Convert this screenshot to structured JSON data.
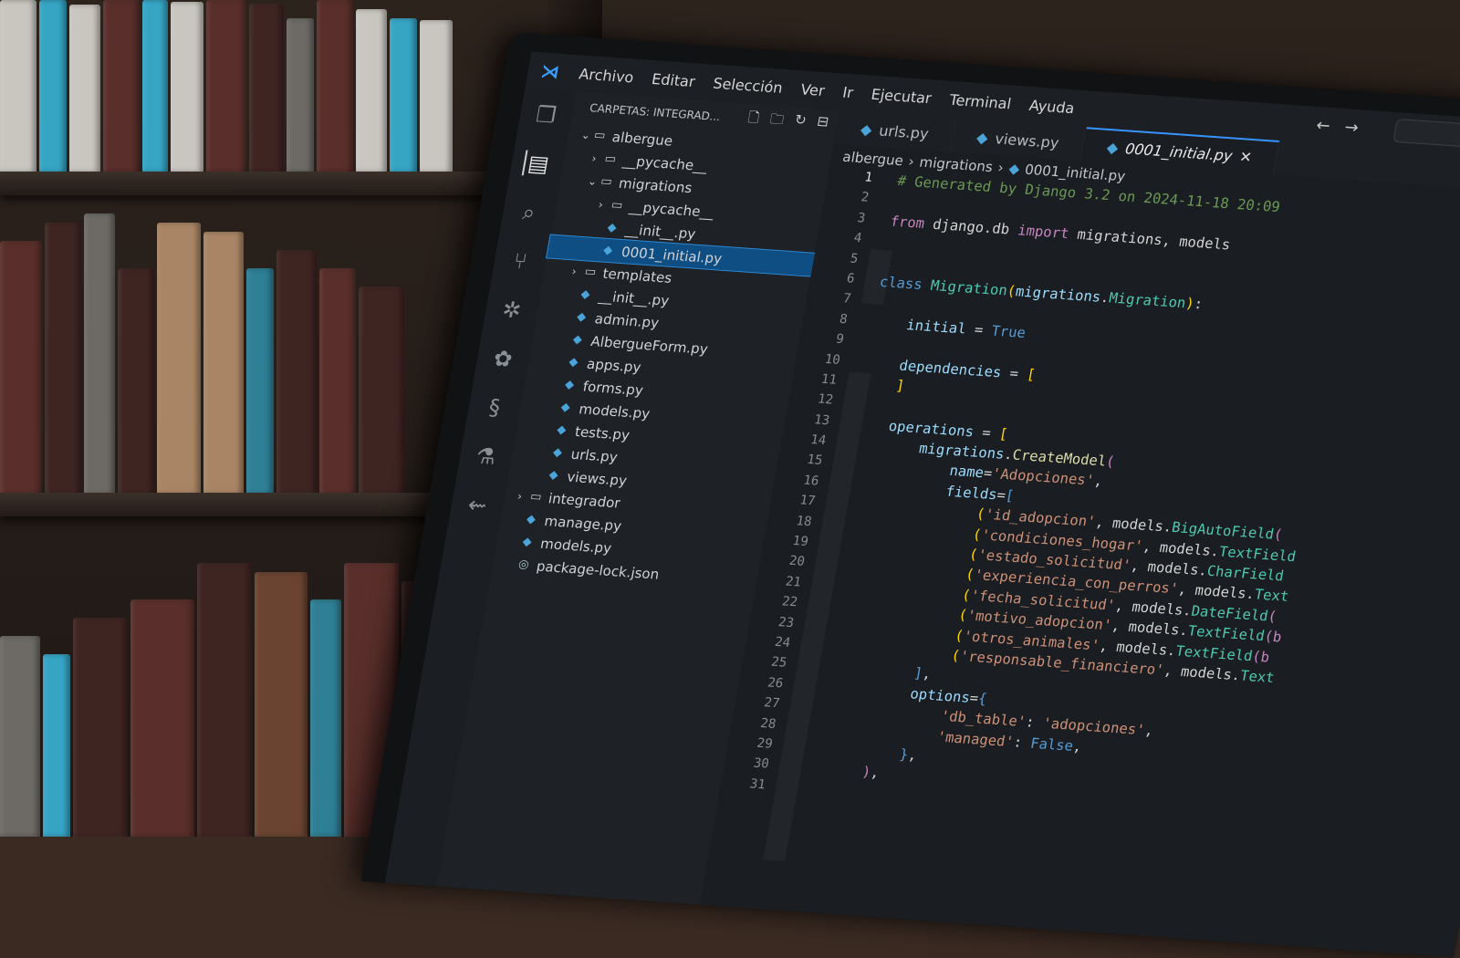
{
  "menu": {
    "items": [
      "Archivo",
      "Editar",
      "Selección",
      "Ver",
      "Ir",
      "Ejecutar",
      "Terminal",
      "Ayuda"
    ],
    "back_arrow": "←",
    "forward_arrow": "→"
  },
  "activity_bar": [
    "files-icon",
    "explorer-icon",
    "search-icon",
    "source-control-icon",
    "debug-icon",
    "extensions-icon",
    "python-icon",
    "testing-icon",
    "remote-icon"
  ],
  "sidebar": {
    "header": "CARPETAS: INTEGRAD...",
    "tree": [
      {
        "label": "albergue",
        "type": "folder",
        "open": true,
        "indent": 0
      },
      {
        "label": "__pycache__",
        "type": "folder",
        "open": false,
        "indent": 1
      },
      {
        "label": "migrations",
        "type": "folder",
        "open": true,
        "indent": 1
      },
      {
        "label": "__pycache__",
        "type": "folder",
        "open": false,
        "indent": 2
      },
      {
        "label": "__init__.py",
        "type": "py",
        "indent": 2
      },
      {
        "label": "0001_initial.py",
        "type": "py",
        "indent": 2,
        "selected": true
      },
      {
        "label": "templates",
        "type": "folder",
        "open": false,
        "indent": 1
      },
      {
        "label": "__init__.py",
        "type": "py",
        "indent": 1
      },
      {
        "label": "admin.py",
        "type": "py",
        "indent": 1
      },
      {
        "label": "AlbergueForm.py",
        "type": "py",
        "indent": 1
      },
      {
        "label": "apps.py",
        "type": "py",
        "indent": 1
      },
      {
        "label": "forms.py",
        "type": "py",
        "indent": 1
      },
      {
        "label": "models.py",
        "type": "py",
        "indent": 1
      },
      {
        "label": "tests.py",
        "type": "py",
        "indent": 1
      },
      {
        "label": "urls.py",
        "type": "py",
        "indent": 1
      },
      {
        "label": "views.py",
        "type": "py",
        "indent": 1
      },
      {
        "label": "integrador",
        "type": "folder",
        "open": false,
        "indent": 0
      },
      {
        "label": "manage.py",
        "type": "py",
        "indent": 0
      },
      {
        "label": "models.py",
        "type": "py",
        "indent": 0
      },
      {
        "label": "package-lock.json",
        "type": "json",
        "indent": 0
      }
    ]
  },
  "tabs": [
    {
      "label": "urls.py",
      "active": false
    },
    {
      "label": "views.py",
      "active": false
    },
    {
      "label": "0001_initial.py",
      "active": true
    }
  ],
  "breadcrumb": [
    "albergue",
    "migrations",
    "0001_initial.py"
  ],
  "code": [
    [
      [
        "c-com",
        "# Generated by Django 3.2 on 2024-11-18 20:09"
      ]
    ],
    [],
    [
      [
        "c-kw",
        "from"
      ],
      [
        "src",
        " django.db "
      ],
      [
        "c-kw",
        "import"
      ],
      [
        "src",
        " migrations, models"
      ]
    ],
    [],
    [],
    [
      [
        "c-bool",
        "class"
      ],
      [
        "src",
        " "
      ],
      [
        "c-cls",
        "Migration"
      ],
      [
        "c-br",
        "("
      ],
      [
        "c-var",
        "migrations"
      ],
      [
        "src",
        "."
      ],
      [
        "c-cls",
        "Migration"
      ],
      [
        "c-br",
        ")"
      ],
      [
        "src",
        ":"
      ]
    ],
    [],
    [
      [
        "src",
        "    "
      ],
      [
        "c-var",
        "initial"
      ],
      [
        "src",
        " = "
      ],
      [
        "c-bool",
        "True"
      ]
    ],
    [],
    [
      [
        "src",
        "    "
      ],
      [
        "c-var",
        "dependencies"
      ],
      [
        "src",
        " = "
      ],
      [
        "c-br",
        "["
      ]
    ],
    [
      [
        "src",
        "    "
      ],
      [
        "c-br",
        "]"
      ]
    ],
    [],
    [
      [
        "src",
        "    "
      ],
      [
        "c-var",
        "operations"
      ],
      [
        "src",
        " = "
      ],
      [
        "c-br",
        "["
      ]
    ],
    [
      [
        "src",
        "        "
      ],
      [
        "c-var",
        "migrations"
      ],
      [
        "src",
        "."
      ],
      [
        "c-fn",
        "CreateModel"
      ],
      [
        "c-kw",
        "("
      ]
    ],
    [
      [
        "src",
        "            "
      ],
      [
        "c-var",
        "name"
      ],
      [
        "src",
        "="
      ],
      [
        "c-str",
        "'Adopciones'"
      ],
      [
        "src",
        ","
      ]
    ],
    [
      [
        "src",
        "            "
      ],
      [
        "c-var",
        "fields"
      ],
      [
        "src",
        "="
      ],
      [
        "c-bool",
        "["
      ]
    ],
    [
      [
        "src",
        "                "
      ],
      [
        "c-br",
        "("
      ],
      [
        "c-str",
        "'id_adopcion'"
      ],
      [
        "src",
        ", models."
      ],
      [
        "c-cls",
        "BigAutoField"
      ],
      [
        "c-kw",
        "("
      ]
    ],
    [
      [
        "src",
        "                "
      ],
      [
        "c-br",
        "("
      ],
      [
        "c-str",
        "'condiciones_hogar'"
      ],
      [
        "src",
        ", models."
      ],
      [
        "c-cls",
        "TextField"
      ]
    ],
    [
      [
        "src",
        "                "
      ],
      [
        "c-br",
        "("
      ],
      [
        "c-str",
        "'estado_solicitud'"
      ],
      [
        "src",
        ", models."
      ],
      [
        "c-cls",
        "CharField"
      ]
    ],
    [
      [
        "src",
        "                "
      ],
      [
        "c-br",
        "("
      ],
      [
        "c-str",
        "'experiencia_con_perros'"
      ],
      [
        "src",
        ", models."
      ],
      [
        "c-cls",
        "Text"
      ]
    ],
    [
      [
        "src",
        "                "
      ],
      [
        "c-br",
        "("
      ],
      [
        "c-str",
        "'fecha_solicitud'"
      ],
      [
        "src",
        ", models."
      ],
      [
        "c-cls",
        "DateField"
      ],
      [
        "c-kw",
        "("
      ]
    ],
    [
      [
        "src",
        "                "
      ],
      [
        "c-br",
        "("
      ],
      [
        "c-str",
        "'motivo_adopcion'"
      ],
      [
        "src",
        ", models."
      ],
      [
        "c-cls",
        "TextField"
      ],
      [
        "c-kw",
        "(b"
      ]
    ],
    [
      [
        "src",
        "                "
      ],
      [
        "c-br",
        "("
      ],
      [
        "c-str",
        "'otros_animales'"
      ],
      [
        "src",
        ", models."
      ],
      [
        "c-cls",
        "TextField"
      ],
      [
        "c-kw",
        "(b"
      ]
    ],
    [
      [
        "src",
        "                "
      ],
      [
        "c-br",
        "("
      ],
      [
        "c-str",
        "'responsable_financiero'"
      ],
      [
        "src",
        ", models."
      ],
      [
        "c-cls",
        "Text"
      ]
    ],
    [
      [
        "src",
        "            "
      ],
      [
        "c-bool",
        "]"
      ],
      [
        "src",
        ","
      ]
    ],
    [
      [
        "src",
        "            "
      ],
      [
        "c-var",
        "options"
      ],
      [
        "src",
        "="
      ],
      [
        "c-bool",
        "{"
      ]
    ],
    [
      [
        "src",
        "                "
      ],
      [
        "c-str",
        "'db_table'"
      ],
      [
        "src",
        ": "
      ],
      [
        "c-str",
        "'adopciones'"
      ],
      [
        "src",
        ","
      ]
    ],
    [
      [
        "src",
        "                "
      ],
      [
        "c-str",
        "'managed'"
      ],
      [
        "src",
        ": "
      ],
      [
        "c-bool",
        "False"
      ],
      [
        "src",
        ","
      ]
    ],
    [
      [
        "src",
        "            "
      ],
      [
        "c-bool",
        "}"
      ],
      [
        "src",
        ","
      ]
    ],
    [
      [
        "src",
        "        "
      ],
      [
        "c-kw",
        ")"
      ],
      [
        "src",
        ","
      ]
    ],
    []
  ]
}
